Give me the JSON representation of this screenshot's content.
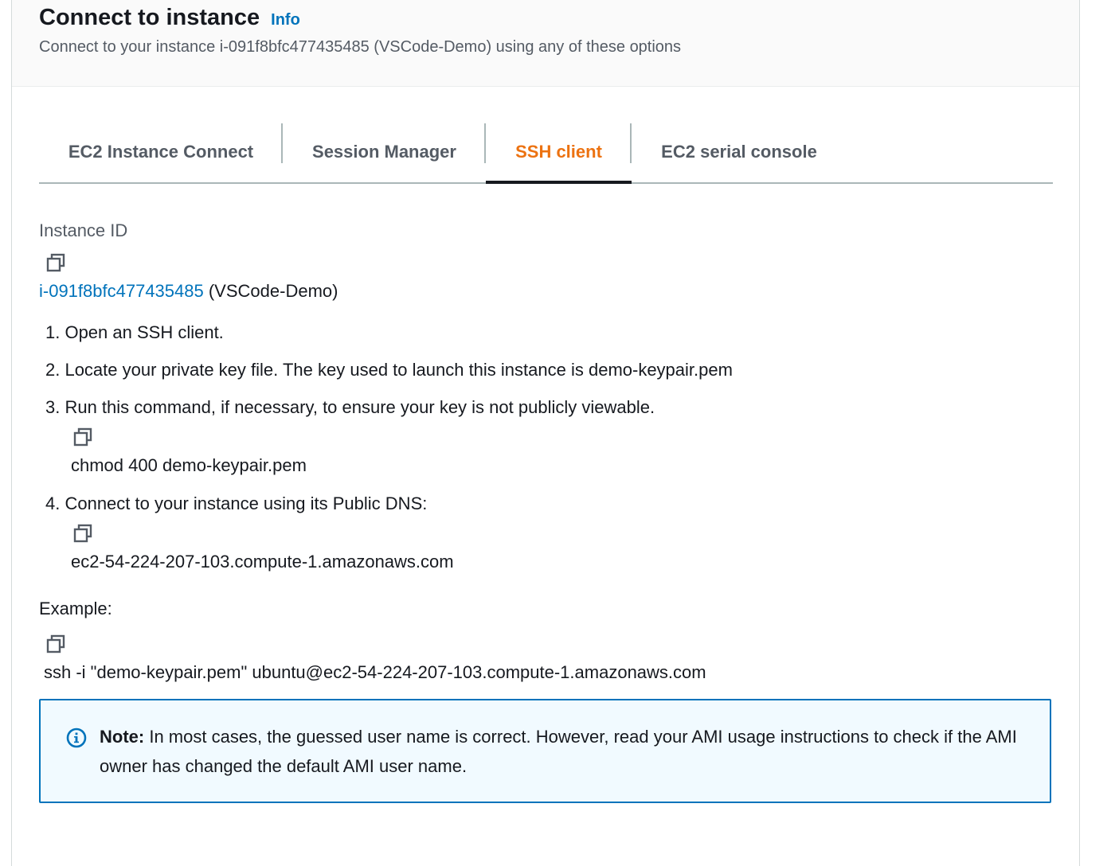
{
  "header": {
    "title": "Connect to instance",
    "info_label": "Info",
    "subtitle": "Connect to your instance i-091f8bfc477435485 (VSCode-Demo) using any of these options"
  },
  "tabs": [
    {
      "label": "EC2 Instance Connect",
      "active": false
    },
    {
      "label": "Session Manager",
      "active": false
    },
    {
      "label": "SSH client",
      "active": true
    },
    {
      "label": "EC2 serial console",
      "active": false
    }
  ],
  "instance": {
    "label": "Instance ID",
    "id": "i-091f8bfc477435485",
    "name": "(VSCode-Demo)"
  },
  "steps": [
    {
      "text": "1. Open an SSH client."
    },
    {
      "text": "2. Locate your private key file. The key used to launch this instance is demo-keypair.pem"
    },
    {
      "text": "3. Run this command, if necessary, to ensure your key is not publicly viewable.",
      "command": "chmod 400 demo-keypair.pem"
    },
    {
      "text": "4. Connect to your instance using its Public DNS:",
      "command": "ec2-54-224-207-103.compute-1.amazonaws.com"
    }
  ],
  "example": {
    "label": "Example:",
    "command": "ssh -i \"demo-keypair.pem\" ubuntu@ec2-54-224-207-103.compute-1.amazonaws.com"
  },
  "note": {
    "prefix": "Note:",
    "text": " In most cases, the guessed user name is correct. However, read your AMI usage instructions to check if the AMI owner has changed the default AMI user name."
  },
  "icons": {
    "copy": "copy-icon",
    "info": "info-circle-icon"
  },
  "colors": {
    "accent_orange": "#ec7211",
    "link_blue": "#0073bb",
    "note_bg": "#f1faff"
  }
}
